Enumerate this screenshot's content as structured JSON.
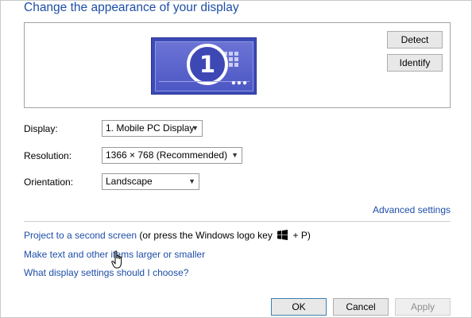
{
  "header": {
    "title": "Change the appearance of your display"
  },
  "preview": {
    "monitor_number": "1",
    "detect_label": "Detect",
    "identify_label": "Identify",
    "taskbar_dots": "●●●"
  },
  "settings": {
    "display": {
      "label": "Display:",
      "value": "1. Mobile PC Display"
    },
    "resolution": {
      "label": "Resolution:",
      "value": "1366 × 768 (Recommended)"
    },
    "orientation": {
      "label": "Orientation:",
      "value": "Landscape"
    }
  },
  "links": {
    "advanced": "Advanced settings",
    "project_link": "Project to a second screen",
    "project_hint_before": "(or press the Windows logo key",
    "project_hint_after": "+ P)",
    "text_size": "Make text and other items larger or smaller",
    "help": "What display settings should I choose?"
  },
  "footer": {
    "ok_label": "OK",
    "cancel_label": "Cancel",
    "apply_label": "Apply"
  },
  "icons": {
    "windows_logo": "windows-logo-icon",
    "cursor": "hand-pointer-icon",
    "chevron": "chevron-down-icon"
  },
  "colors": {
    "link": "#1e4ea8",
    "monitor": "#3b4ab7"
  }
}
